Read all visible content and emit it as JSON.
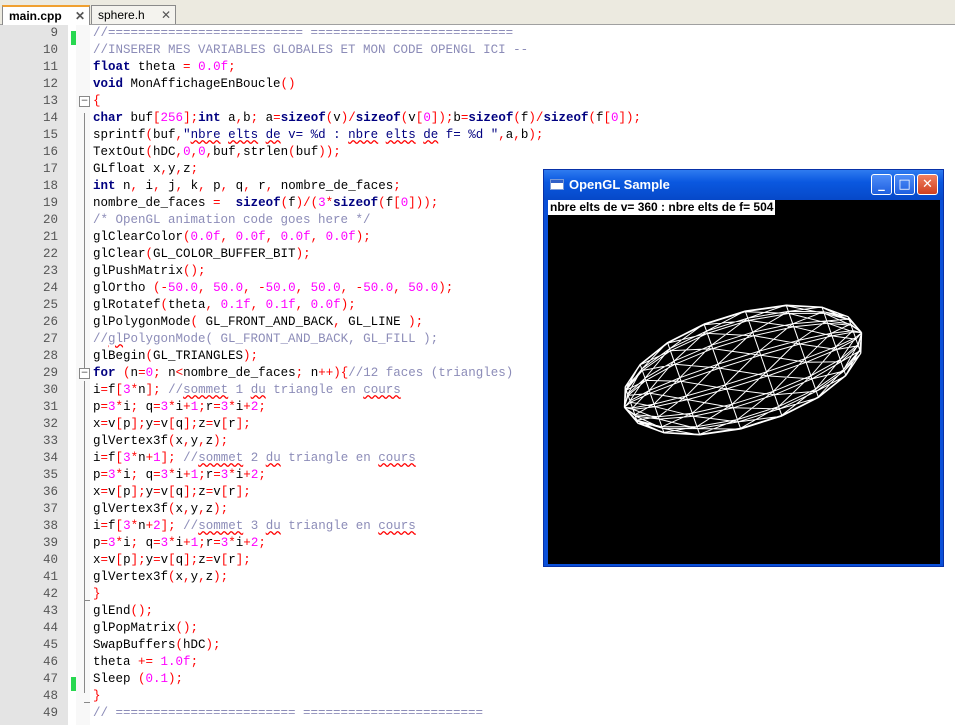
{
  "tabs": [
    {
      "label": "main.cpp",
      "close": "✕"
    },
    {
      "label": "sphere.h",
      "close": "✕"
    }
  ],
  "code_lines": [
    {
      "n": "9",
      "html": "<span class=\"cm\">//========================== ===========================</span>"
    },
    {
      "n": "10",
      "html": "<span class=\"cm\">//INSERER MES VARIABLES GLOBALES ET MON CODE OPENGL ICI --</span>"
    },
    {
      "n": "11",
      "html": "<span class=\"kw\">float</span> theta <span class=\"op\">=</span> <span class=\"num\">0.0f</span><span class=\"op\">;</span>"
    },
    {
      "n": "12",
      "html": "<span class=\"kw\">void</span> MonAffichageEnBoucle<span class=\"op\">()</span>"
    },
    {
      "n": "13",
      "html": "<span class=\"op\">{</span>"
    },
    {
      "n": "14",
      "html": "<span class=\"kw\">char</span> buf<span class=\"op\">[</span><span class=\"num\">256</span><span class=\"op\">];</span><span class=\"kw\">int</span> a<span class=\"op\">,</span>b<span class=\"op\">;</span> a<span class=\"op\">=</span><span class=\"kw\">sizeof</span><span class=\"op\">(</span>v<span class=\"op\">)/</span><span class=\"kw\">sizeof</span><span class=\"op\">(</span>v<span class=\"op\">[</span><span class=\"num\">0</span><span class=\"op\">]);</span>b<span class=\"op\">=</span><span class=\"kw\">sizeof</span><span class=\"op\">(</span>f<span class=\"op\">)/</span><span class=\"kw\">sizeof</span><span class=\"op\">(</span>f<span class=\"op\">[</span><span class=\"num\">0</span><span class=\"op\">]);</span>"
    },
    {
      "n": "15",
      "html": "sprintf<span class=\"op\">(</span>buf<span class=\"op\">,</span><span class=\"str\">\"<span class=\"sq\">nbre</span> <span class=\"sq\">elts</span> <span class=\"sq\">de</span> v= %d : <span class=\"sq\">nbre</span> <span class=\"sq\">elts</span> <span class=\"sq\">de</span> f= %d \"</span><span class=\"op\">,</span>a<span class=\"op\">,</span>b<span class=\"op\">);</span>"
    },
    {
      "n": "16",
      "html": "TextOut<span class=\"op\">(</span>hDC<span class=\"op\">,</span><span class=\"num\">0</span><span class=\"op\">,</span><span class=\"num\">0</span><span class=\"op\">,</span>buf<span class=\"op\">,</span>strlen<span class=\"op\">(</span>buf<span class=\"op\">));</span>"
    },
    {
      "n": "17",
      "html": "GLfloat x<span class=\"op\">,</span>y<span class=\"op\">,</span>z<span class=\"op\">;</span>"
    },
    {
      "n": "18",
      "html": "<span class=\"kw\">int</span> n<span class=\"op\">,</span> i<span class=\"op\">,</span> j<span class=\"op\">,</span> k<span class=\"op\">,</span> p<span class=\"op\">,</span> q<span class=\"op\">,</span> r<span class=\"op\">,</span> nombre_de_faces<span class=\"op\">;</span>"
    },
    {
      "n": "19",
      "html": "nombre_de_faces <span class=\"op\">=</span>  <span class=\"kw\">sizeof</span><span class=\"op\">(</span>f<span class=\"op\">)/(</span><span class=\"num\">3</span><span class=\"op\">*</span><span class=\"kw\">sizeof</span><span class=\"op\">(</span>f<span class=\"op\">[</span><span class=\"num\">0</span><span class=\"op\">]));</span>"
    },
    {
      "n": "20",
      "html": "<span class=\"cm\">/* OpenGL animation code goes here */</span>"
    },
    {
      "n": "21",
      "html": "glClearColor<span class=\"op\">(</span><span class=\"num\">0.0f</span><span class=\"op\">,</span> <span class=\"num\">0.0f</span><span class=\"op\">,</span> <span class=\"num\">0.0f</span><span class=\"op\">,</span> <span class=\"num\">0.0f</span><span class=\"op\">);</span>"
    },
    {
      "n": "22",
      "html": "glClear<span class=\"op\">(</span>GL_COLOR_BUFFER_BIT<span class=\"op\">);</span>"
    },
    {
      "n": "23",
      "html": "glPushMatrix<span class=\"op\">();</span>"
    },
    {
      "n": "24",
      "html": "glOrtho <span class=\"op\">(-</span><span class=\"num\">50.0</span><span class=\"op\">,</span> <span class=\"num\">50.0</span><span class=\"op\">, -</span><span class=\"num\">50.0</span><span class=\"op\">,</span> <span class=\"num\">50.0</span><span class=\"op\">, -</span><span class=\"num\">50.0</span><span class=\"op\">,</span> <span class=\"num\">50.0</span><span class=\"op\">);</span>"
    },
    {
      "n": "25",
      "html": "glRotatef<span class=\"op\">(</span>theta<span class=\"op\">,</span> <span class=\"num\">0.1f</span><span class=\"op\">,</span> <span class=\"num\">0.1f</span><span class=\"op\">,</span> <span class=\"num\">0.0f</span><span class=\"op\">);</span>"
    },
    {
      "n": "26",
      "html": "glPolygonMode<span class=\"op\">(</span> GL_FRONT_AND_BACK<span class=\"op\">,</span> GL_LINE <span class=\"op\">);</span>"
    },
    {
      "n": "27",
      "html": "<span class=\"cm\">//<span class=\"sq\">gl</span>PolygonMode( GL_FRONT_AND_BACK, GL_FILL );</span>"
    },
    {
      "n": "28",
      "html": "glBegin<span class=\"op\">(</span>GL_TRIANGLES<span class=\"op\">);</span>"
    },
    {
      "n": "29",
      "html": "<span class=\"kw\">for</span> <span class=\"op\">(</span>n<span class=\"op\">=</span><span class=\"num\">0</span><span class=\"op\">;</span> n<span class=\"op\">&lt;</span>nombre_de_faces<span class=\"op\">;</span> n<span class=\"op\">++){</span><span class=\"cm\">//12 faces (triangles)</span>"
    },
    {
      "n": "30",
      "html": "i<span class=\"op\">=</span>f<span class=\"op\">[</span><span class=\"num\">3</span><span class=\"op\">*</span>n<span class=\"op\">];</span> <span class=\"cm\">//<span class=\"sq\">sommet</span> 1 <span class=\"sq\">du</span> triangle en <span class=\"sq\">cours</span></span>"
    },
    {
      "n": "31",
      "html": "p<span class=\"op\">=</span><span class=\"num\">3</span><span class=\"op\">*</span>i<span class=\"op\">;</span> q<span class=\"op\">=</span><span class=\"num\">3</span><span class=\"op\">*</span>i<span class=\"op\">+</span><span class=\"num\">1</span><span class=\"op\">;</span>r<span class=\"op\">=</span><span class=\"num\">3</span><span class=\"op\">*</span>i<span class=\"op\">+</span><span class=\"num\">2</span><span class=\"op\">;</span>"
    },
    {
      "n": "32",
      "html": "x<span class=\"op\">=</span>v<span class=\"op\">[</span>p<span class=\"op\">];</span>y<span class=\"op\">=</span>v<span class=\"op\">[</span>q<span class=\"op\">];</span>z<span class=\"op\">=</span>v<span class=\"op\">[</span>r<span class=\"op\">];</span>"
    },
    {
      "n": "33",
      "html": "glVertex3f<span class=\"op\">(</span>x<span class=\"op\">,</span>y<span class=\"op\">,</span>z<span class=\"op\">);</span>"
    },
    {
      "n": "34",
      "html": "i<span class=\"op\">=</span>f<span class=\"op\">[</span><span class=\"num\">3</span><span class=\"op\">*</span>n<span class=\"op\">+</span><span class=\"num\">1</span><span class=\"op\">];</span> <span class=\"cm\">//<span class=\"sq\">sommet</span> 2 <span class=\"sq\">du</span> triangle en <span class=\"sq\">cours</span></span>"
    },
    {
      "n": "35",
      "html": "p<span class=\"op\">=</span><span class=\"num\">3</span><span class=\"op\">*</span>i<span class=\"op\">;</span> q<span class=\"op\">=</span><span class=\"num\">3</span><span class=\"op\">*</span>i<span class=\"op\">+</span><span class=\"num\">1</span><span class=\"op\">;</span>r<span class=\"op\">=</span><span class=\"num\">3</span><span class=\"op\">*</span>i<span class=\"op\">+</span><span class=\"num\">2</span><span class=\"op\">;</span>"
    },
    {
      "n": "36",
      "html": "x<span class=\"op\">=</span>v<span class=\"op\">[</span>p<span class=\"op\">];</span>y<span class=\"op\">=</span>v<span class=\"op\">[</span>q<span class=\"op\">];</span>z<span class=\"op\">=</span>v<span class=\"op\">[</span>r<span class=\"op\">];</span>"
    },
    {
      "n": "37",
      "html": "glVertex3f<span class=\"op\">(</span>x<span class=\"op\">,</span>y<span class=\"op\">,</span>z<span class=\"op\">);</span>"
    },
    {
      "n": "38",
      "html": "i<span class=\"op\">=</span>f<span class=\"op\">[</span><span class=\"num\">3</span><span class=\"op\">*</span>n<span class=\"op\">+</span><span class=\"num\">2</span><span class=\"op\">];</span> <span class=\"cm\">//<span class=\"sq\">sommet</span> 3 <span class=\"sq\">du</span> triangle en <span class=\"sq\">cours</span></span>"
    },
    {
      "n": "39",
      "html": "p<span class=\"op\">=</span><span class=\"num\">3</span><span class=\"op\">*</span>i<span class=\"op\">;</span> q<span class=\"op\">=</span><span class=\"num\">3</span><span class=\"op\">*</span>i<span class=\"op\">+</span><span class=\"num\">1</span><span class=\"op\">;</span>r<span class=\"op\">=</span><span class=\"num\">3</span><span class=\"op\">*</span>i<span class=\"op\">+</span><span class=\"num\">2</span><span class=\"op\">;</span>"
    },
    {
      "n": "40",
      "html": "x<span class=\"op\">=</span>v<span class=\"op\">[</span>p<span class=\"op\">];</span>y<span class=\"op\">=</span>v<span class=\"op\">[</span>q<span class=\"op\">];</span>z<span class=\"op\">=</span>v<span class=\"op\">[</span>r<span class=\"op\">];</span>"
    },
    {
      "n": "41",
      "html": "glVertex3f<span class=\"op\">(</span>x<span class=\"op\">,</span>y<span class=\"op\">,</span>z<span class=\"op\">);</span>"
    },
    {
      "n": "42",
      "html": "<span class=\"op\">}</span>"
    },
    {
      "n": "43",
      "html": "glEnd<span class=\"op\">();</span>"
    },
    {
      "n": "44",
      "html": "glPopMatrix<span class=\"op\">();</span>"
    },
    {
      "n": "45",
      "html": "SwapBuffers<span class=\"op\">(</span>hDC<span class=\"op\">);</span>"
    },
    {
      "n": "46",
      "html": "theta <span class=\"op\">+=</span> <span class=\"num\">1.0f</span><span class=\"op\">;</span>"
    },
    {
      "n": "47",
      "html": "Sleep <span class=\"op\">(</span><span class=\"num\">0.1</span><span class=\"op\">);</span>"
    },
    {
      "n": "48",
      "html": "<span class=\"op\">}</span>"
    },
    {
      "n": "49",
      "html": "<span class=\"cm\">// ======================== ========================</span>"
    }
  ],
  "gl_window": {
    "title": "OpenGL Sample",
    "info_text": "nbre elts de v= 360 : nbre elts de f= 504",
    "minimize": "_",
    "maximize": "□",
    "close": "✕"
  },
  "colors": {
    "keyword": "#000080",
    "number": "#ff00ff",
    "comment": "#8c8cb8",
    "change_bar": "#28d850",
    "xp_title": "#0a58e0"
  }
}
